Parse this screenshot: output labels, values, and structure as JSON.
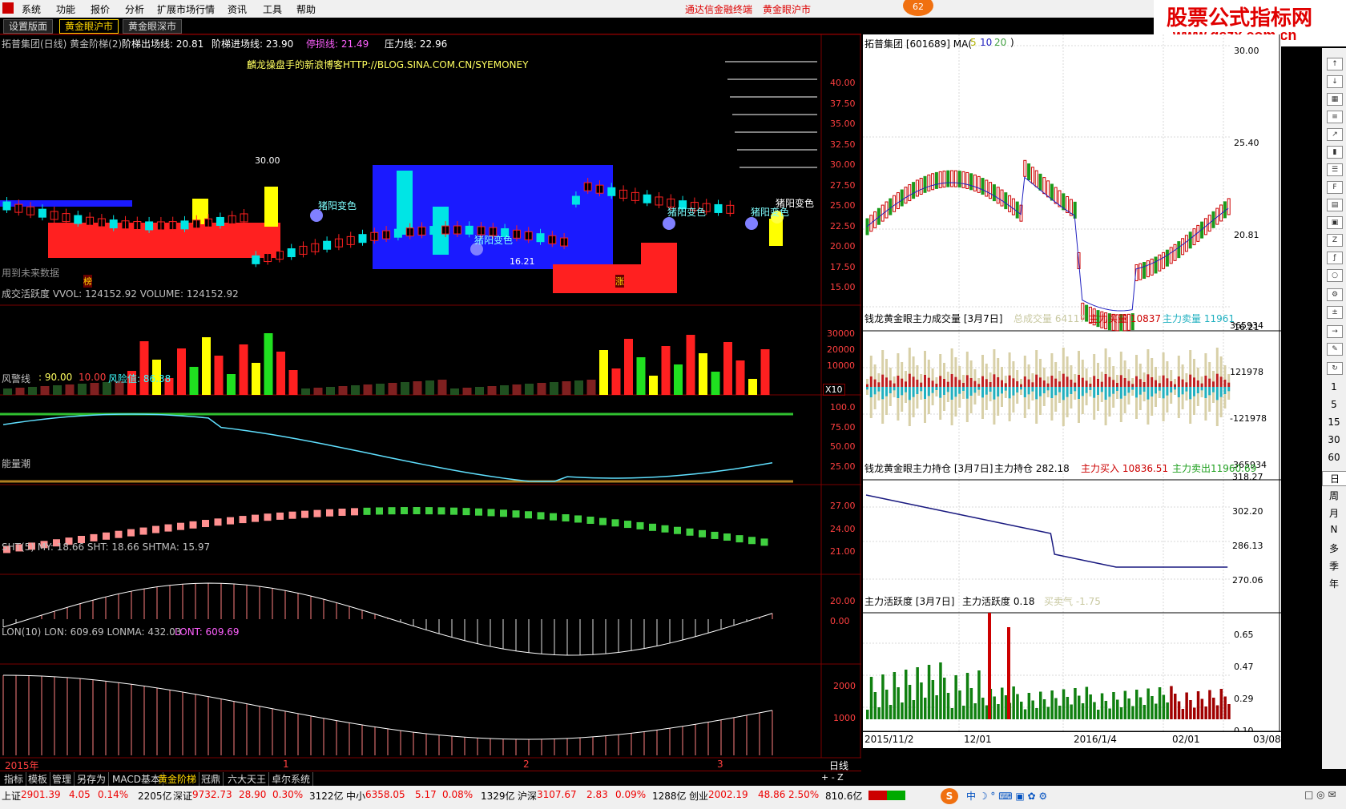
{
  "menu": {
    "items": [
      "系统",
      "功能",
      "报价",
      "分析",
      "扩展市场行情",
      "资讯",
      "工具",
      "帮助"
    ],
    "center_title_1": "通达信金融终端",
    "center_title_2": "黄金眼沪市",
    "badge": "62"
  },
  "tabs": [
    "设置版面",
    "黄金眼沪市",
    "黄金眼深市"
  ],
  "logo": {
    "line1": "股票公式指标网",
    "line2": "www.gszx.com.cn"
  },
  "main_chart": {
    "header": {
      "name": "拓普集团(日线) 黄金阶梯(2)",
      "exit": "阶梯出场线: 20.81",
      "entry": "阶梯进场线: 23.90",
      "stop": "停损线: 21.49",
      "pressure": "压力线: 22.96"
    },
    "blog": "麟龙操盘手的新浪博客HTTP://BLOG.SINA.COM.CN/SYEMONEY",
    "hi_label": "30.00",
    "lo_label": "16.21",
    "future_note": "用到未来数据",
    "change_labels": [
      "猪阳变色",
      "猪阳变色",
      "猪阳变色",
      "猪阳变色",
      "猪阳变色"
    ],
    "marker_bang": "榜",
    "marker_zhang": "涨",
    "y_ticks": [
      "40.00",
      "37.50",
      "35.00",
      "32.50",
      "30.00",
      "27.50",
      "25.00",
      "22.50",
      "20.00",
      "17.50",
      "15.00"
    ]
  },
  "volume_panel": {
    "header": "成交活跃度 VVOL: 124152.92  VOLUME: 124152.92",
    "y_ticks": [
      "30000",
      "20000",
      "10000"
    ],
    "unit": "X10"
  },
  "risk_panel": {
    "header_name": "风警线",
    "v1": ": 90.00",
    "v2": "10.00",
    "risk": "风险值: 86.38",
    "y_ticks": [
      "100.0",
      "75.00",
      "50.00",
      "25.00"
    ]
  },
  "energy_panel": {
    "header": "能量潮",
    "y_ticks": [
      "27.00",
      "24.00",
      "21.00"
    ]
  },
  "sht_panel": {
    "header": "SHT(5)  MY: 18.66  SHT: 18.66  SHTMA: 15.97",
    "y_ticks": [
      "20.00",
      "0.00"
    ]
  },
  "lon_panel": {
    "header": "LON(10)  LON: 609.69  LONMA: 432.03",
    "lont": "LONT: 609.69",
    "y_ticks": [
      "2000",
      "1000"
    ]
  },
  "time_axis": {
    "year": "2015年",
    "m1": "1",
    "m2": "2",
    "m3": "3",
    "period": "日线"
  },
  "right_kline": {
    "header": "拓普集团  [601689]  MA(",
    "ma": [
      "5",
      "10",
      "20"
    ],
    "header_end": ")",
    "y_ticks": [
      "30.00",
      "25.40",
      "20.81",
      "16.21"
    ]
  },
  "right_vol": {
    "title": "钱龙黄金眼主力成交量 [3月7日]",
    "total": "总成交量 64117",
    "buy": "主力买量 10837",
    "sell": "主力卖量 11961",
    "y_ticks": [
      "365934",
      "121978",
      "-121978",
      "-365934"
    ]
  },
  "right_hold": {
    "title": "钱龙黄金眼主力持仓 [3月7日]",
    "hold": "主力持仓 282.18",
    "buy": "主力买入 10836.51",
    "sell": "主力卖出11960.69",
    "y_ticks": [
      "318.27",
      "302.20",
      "286.13",
      "270.06"
    ]
  },
  "right_active": {
    "title": "主力活跃度 [3月7日]",
    "value": "主力活跃度 0.18",
    "buysell": "买卖气 -1.75",
    "y_ticks": [
      "0.65",
      "0.47",
      "0.29",
      "0.10"
    ]
  },
  "right_dates": [
    "2015/11/2",
    "12/01",
    "2016/1/4",
    "02/01",
    "03/08"
  ],
  "right_toolbar_text": [
    "1",
    "5",
    "15",
    "30",
    "60",
    "日",
    "周",
    "月",
    "N",
    "多",
    "季",
    "年"
  ],
  "bottom_tabs": [
    "指标",
    "模板",
    "管理",
    "另存为",
    "MACD基本",
    "黄金阶梯",
    "冠鼎",
    "六大天王",
    "卓尔系统"
  ],
  "status": {
    "sh": "上证",
    "sh_val": "2901.39",
    "sh_chg": "4.05",
    "sh_pct": "0.14%",
    "sh_amt": "2205亿",
    "sz": "深证",
    "sz_val": "9732.73",
    "sz_chg": "28.90",
    "sz_pct": "0.30%",
    "sz_amt": "3122亿",
    "zx": "中小",
    "zx_val": "6358.05",
    "zx_chg": "5.17",
    "zx_pct": "0.08%",
    "zx_amt": "1329亿",
    "hs": "沪深",
    "hs_val": "3107.67",
    "hs_chg": "2.83",
    "hs_pct": "0.09%",
    "hs_amt": "1288亿",
    "cy": "创业",
    "cy_val": "2002.19",
    "cy_chg": "48.86",
    "cy_pct": "2.50%",
    "cy_amt": "810.6亿"
  },
  "colors": {
    "up": "#ff2020",
    "down": "#00e5e5",
    "yellow": "#ffff00",
    "blue": "#1a1aff",
    "grid": "#7a0000"
  }
}
